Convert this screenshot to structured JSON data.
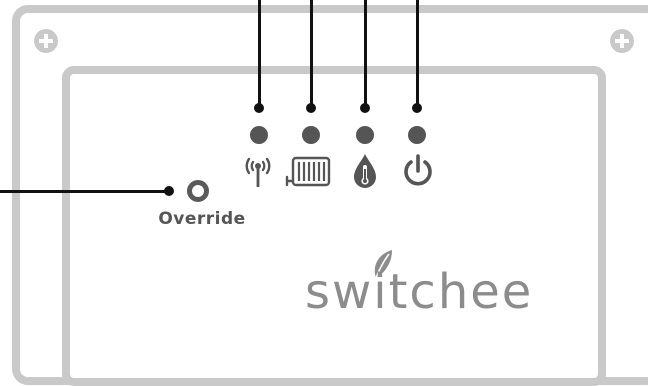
{
  "override": {
    "label": "Override"
  },
  "brand": {
    "name": "switchee",
    "leaf_icon": "leaf-icon"
  },
  "indicators": [
    {
      "name": "signal",
      "icon": "signal-icon"
    },
    {
      "name": "heating",
      "icon": "radiator-icon"
    },
    {
      "name": "temperature",
      "icon": "thermometer-drop-icon"
    },
    {
      "name": "power",
      "icon": "power-icon"
    }
  ],
  "colors": {
    "frame": "#c9c9c9",
    "led": "#555555",
    "wire": "#111111",
    "text": "#555555",
    "brand": "#8c8c8c"
  }
}
